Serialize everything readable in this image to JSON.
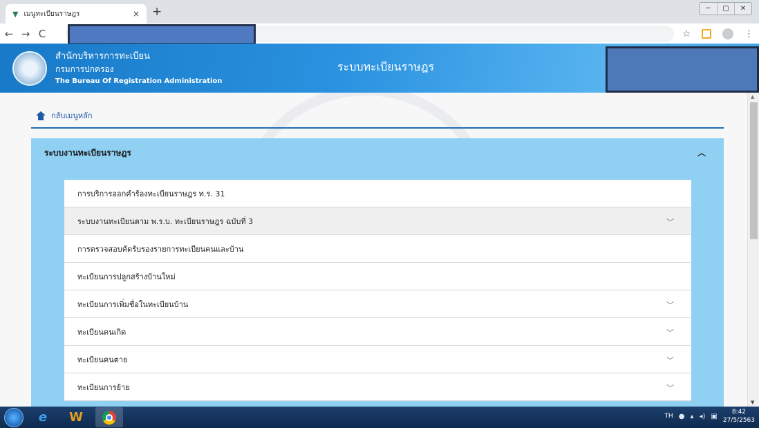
{
  "browser": {
    "tab_title": "เมนูทะเบียนราษฎร",
    "tab_close": "×",
    "new_tab": "+",
    "win_min": "─",
    "win_max": "▢",
    "win_close": "✕",
    "back": "←",
    "forward": "→",
    "reload": "C",
    "star": "☆",
    "menu": "⋮"
  },
  "header": {
    "org_th_1": "สำนักบริหารการทะเบียน",
    "org_th_2": "กรมการปกครอง",
    "org_en": "The Bureau Of Registration Administration",
    "app_title": "ระบบทะเบียนราษฎร"
  },
  "page": {
    "back_label": "กลับเมนูหลัก",
    "panel_title": "ระบบงานทะเบียนราษฎร",
    "panel_chevron": "︿",
    "chevron": "﹀",
    "items": [
      {
        "label": "การบริการออกคำร้องทะเบียนราษฎร ท.ร. 31",
        "expandable": false
      },
      {
        "label": "ระบบงานทะเบียนตาม พ.ร.บ. ทะเบียนราษฎร ฉบับที่ 3",
        "expandable": true
      },
      {
        "label": "การตรวจสอบคัดรับรองรายการทะเบียนคนและบ้าน",
        "expandable": false
      },
      {
        "label": "ทะเบียนการปลูกสร้างบ้านใหม่",
        "expandable": false
      },
      {
        "label": "ทะเบียนการเพิ่มชื่อในทะเบียนบ้าน",
        "expandable": true
      },
      {
        "label": "ทะเบียนคนเกิด",
        "expandable": true
      },
      {
        "label": "ทะเบียนคนตาย",
        "expandable": true
      },
      {
        "label": "ทะเบียนการย้าย",
        "expandable": true
      }
    ]
  },
  "taskbar": {
    "lang": "TH",
    "time": "8:42",
    "date": "27/5/2563"
  }
}
